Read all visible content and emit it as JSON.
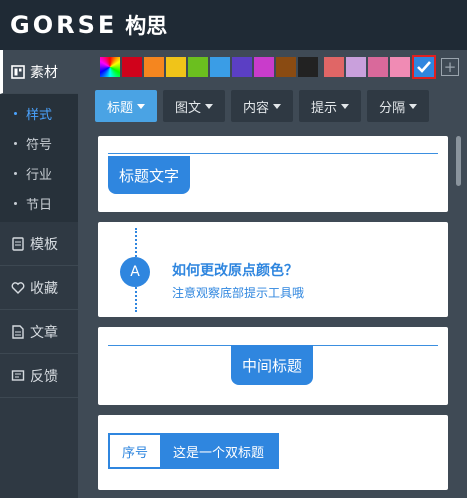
{
  "app": {
    "logo_text": "GORSE",
    "logo_cn": "构思"
  },
  "sidebar": {
    "items": [
      {
        "label": "素材",
        "icon": "image-icon"
      },
      {
        "label": "模板",
        "icon": "template-icon"
      },
      {
        "label": "收藏",
        "icon": "heart-icon"
      },
      {
        "label": "文章",
        "icon": "article-icon"
      },
      {
        "label": "反馈",
        "icon": "feedback-icon"
      }
    ],
    "sub_items": [
      {
        "label": "样式",
        "active": true
      },
      {
        "label": "符号",
        "active": false
      },
      {
        "label": "行业",
        "active": false
      },
      {
        "label": "节日",
        "active": false
      }
    ]
  },
  "colors": {
    "swatches": [
      "rainbow",
      "#d0021b",
      "#f5861f",
      "#f0c419",
      "#6bbf1f",
      "#3a9de6",
      "#5b3fc4",
      "#c93ccb",
      "#8a4b12",
      "#222222",
      "#e06666",
      "#c9a0dc",
      "#d9699b",
      "#f08bb4",
      "#2f86df"
    ],
    "selected": "#2f86df"
  },
  "tabs": [
    {
      "label": "标题",
      "active": true
    },
    {
      "label": "图文",
      "active": false
    },
    {
      "label": "内容",
      "active": false
    },
    {
      "label": "提示",
      "active": false
    },
    {
      "label": "分隔",
      "active": false
    }
  ],
  "cards": {
    "c1": {
      "text": "标题文字"
    },
    "c2": {
      "badge": "A",
      "title": "如何更改原点颜色？",
      "subtitle": "注意观察底部提示工具哦"
    },
    "c3": {
      "text": "中间标题"
    },
    "c4": {
      "number": "序号",
      "text": "这是一个双标题"
    }
  }
}
